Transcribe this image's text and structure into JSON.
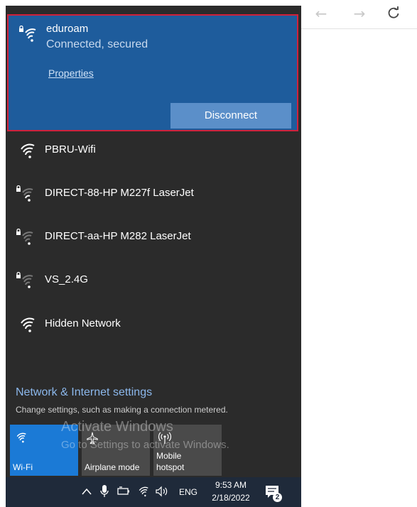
{
  "browser": {
    "back_glyph": "←",
    "forward_glyph": "→",
    "refresh_glyph": "C"
  },
  "connected_network": {
    "name": "eduroam",
    "status": "Connected, secured",
    "properties_label": "Properties",
    "disconnect_label": "Disconnect",
    "icon": "wifi-secured-icon"
  },
  "networks": [
    {
      "name": "PBRU-Wifi",
      "icon": "wifi-icon"
    },
    {
      "name": "DIRECT-88-HP M227f LaserJet",
      "icon": "wifi-secured-icon"
    },
    {
      "name": "DIRECT-aa-HP M282 LaserJet",
      "icon": "wifi-secured-icon"
    },
    {
      "name": "VS_2.4G",
      "icon": "wifi-secured-icon"
    },
    {
      "name": "Hidden Network",
      "icon": "wifi-icon"
    }
  ],
  "settings": {
    "title": "Network & Internet settings",
    "description": "Change settings, such as making a connection metered."
  },
  "quick_actions": [
    {
      "label": "Wi-Fi",
      "active": true,
      "icon": "wifi-icon"
    },
    {
      "label": "Airplane mode",
      "active": false,
      "icon": "airplane-icon"
    },
    {
      "label": "Mobile\nhotspot",
      "label_line1": "Mobile",
      "label_line2": "hotspot",
      "active": false,
      "icon": "hotspot-icon"
    }
  ],
  "watermark": {
    "line1": "Activate Windows",
    "line2": "Go to Settings to activate Windows."
  },
  "taskbar": {
    "language": "ENG",
    "time": "9:53 AM",
    "date": "2/18/2022",
    "notification_count": "2"
  },
  "colors": {
    "panel_bg": "#2b2b2b",
    "selected_bg": "#1e5c9c",
    "highlight_border": "#d0213b",
    "disconnect_bg": "#5b8fc9",
    "active_tile_bg": "#1b7ad6",
    "inactive_tile_bg": "#4a4a4a",
    "link_color": "#8cb8ec",
    "taskbar_bg": "#1f2a3a"
  }
}
